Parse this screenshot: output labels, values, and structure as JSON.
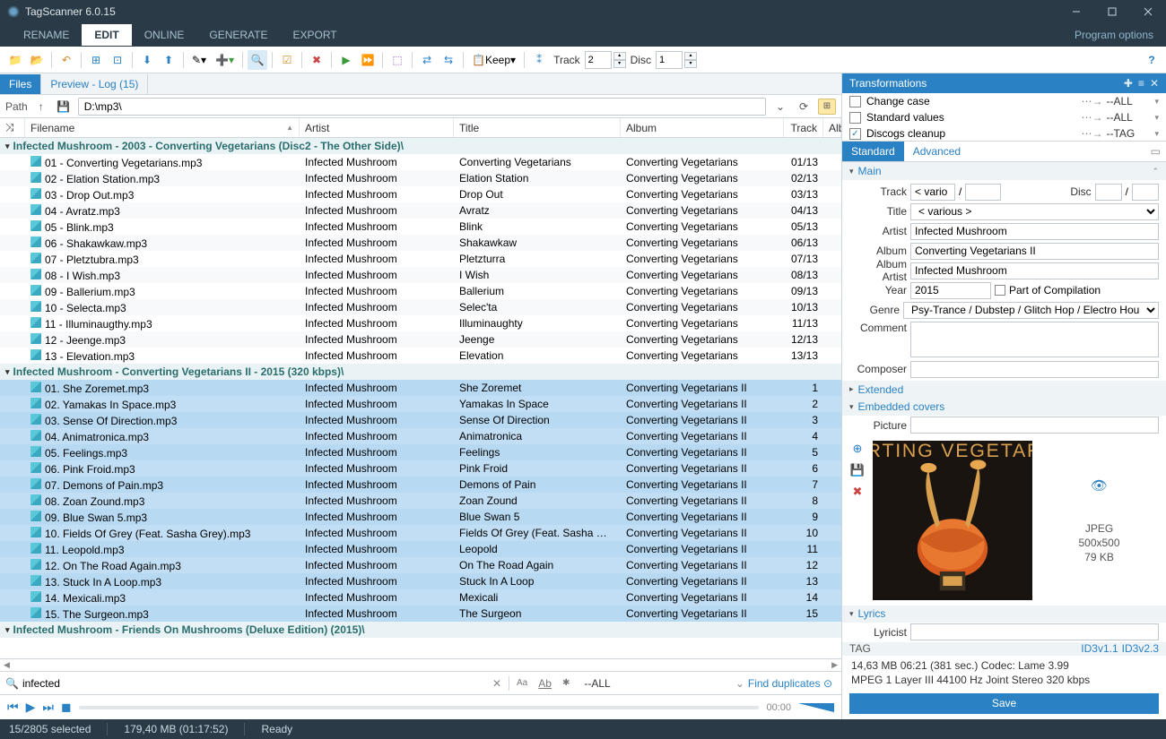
{
  "app": {
    "title": "TagScanner 6.0.15",
    "options_label": "Program options"
  },
  "menu": {
    "tabs": [
      "RENAME",
      "EDIT",
      "ONLINE",
      "GENERATE",
      "EXPORT"
    ],
    "active": 1
  },
  "leftTabs": {
    "files": "Files",
    "preview": "Preview - Log (15)"
  },
  "path": {
    "label": "Path",
    "value": "D:\\mp3\\"
  },
  "toolbar": {
    "keep": "Keep",
    "track_lbl": "Track",
    "track_val": "2",
    "disc_lbl": "Disc",
    "disc_val": "1"
  },
  "columns": {
    "filename": "Filename",
    "artist": "Artist",
    "title": "Title",
    "album": "Album",
    "track": "Track",
    "albart": "Alb"
  },
  "groups": [
    {
      "label": "Infected Mushroom - 2003 - Converting Vegetarians (Disc2 - The Other Side)\\",
      "selected": false,
      "rows": [
        {
          "fn": "01 - Converting Vegetarians.mp3",
          "ar": "Infected Mushroom",
          "ti": "Converting Vegetarians",
          "al": "Converting Vegetarians",
          "tr": "01/13"
        },
        {
          "fn": "02 - Elation Station.mp3",
          "ar": "Infected Mushroom",
          "ti": "Elation Station",
          "al": "Converting Vegetarians",
          "tr": "02/13"
        },
        {
          "fn": "03 - Drop Out.mp3",
          "ar": "Infected Mushroom",
          "ti": "Drop Out",
          "al": "Converting Vegetarians",
          "tr": "03/13"
        },
        {
          "fn": "04 - Avratz.mp3",
          "ar": "Infected Mushroom",
          "ti": "Avratz",
          "al": "Converting Vegetarians",
          "tr": "04/13"
        },
        {
          "fn": "05 - Blink.mp3",
          "ar": "Infected Mushroom",
          "ti": "Blink",
          "al": "Converting Vegetarians",
          "tr": "05/13"
        },
        {
          "fn": "06 - Shakawkaw.mp3",
          "ar": "Infected Mushroom",
          "ti": "Shakawkaw",
          "al": "Converting Vegetarians",
          "tr": "06/13"
        },
        {
          "fn": "07 - Pletztubra.mp3",
          "ar": "Infected Mushroom",
          "ti": "Pletzturra",
          "al": "Converting Vegetarians",
          "tr": "07/13"
        },
        {
          "fn": "08 - I Wish.mp3",
          "ar": "Infected Mushroom",
          "ti": "I Wish",
          "al": "Converting Vegetarians",
          "tr": "08/13"
        },
        {
          "fn": "09 - Ballerium.mp3",
          "ar": "Infected Mushroom",
          "ti": "Ballerium",
          "al": "Converting Vegetarians",
          "tr": "09/13"
        },
        {
          "fn": "10 - Selecta.mp3",
          "ar": "Infected Mushroom",
          "ti": "Selec'ta",
          "al": "Converting Vegetarians",
          "tr": "10/13"
        },
        {
          "fn": "11 - Illuminaugthy.mp3",
          "ar": "Infected Mushroom",
          "ti": "Illuminaughty",
          "al": "Converting Vegetarians",
          "tr": "11/13"
        },
        {
          "fn": "12 - Jeenge.mp3",
          "ar": "Infected Mushroom",
          "ti": "Jeenge",
          "al": "Converting Vegetarians",
          "tr": "12/13"
        },
        {
          "fn": "13 - Elevation.mp3",
          "ar": "Infected Mushroom",
          "ti": "Elevation",
          "al": "Converting Vegetarians",
          "tr": "13/13"
        }
      ]
    },
    {
      "label": "Infected Mushroom - Converting Vegetarians II - 2015 (320 kbps)\\",
      "selected": true,
      "rows": [
        {
          "fn": "01. She Zoremet.mp3",
          "ar": "Infected Mushroom",
          "ti": "She Zoremet",
          "al": "Converting Vegetarians II",
          "tr": "1"
        },
        {
          "fn": "02. Yamakas In Space.mp3",
          "ar": "Infected Mushroom",
          "ti": "Yamakas In Space",
          "al": "Converting Vegetarians II",
          "tr": "2"
        },
        {
          "fn": "03. Sense Of Direction.mp3",
          "ar": "Infected Mushroom",
          "ti": "Sense Of Direction",
          "al": "Converting Vegetarians II",
          "tr": "3"
        },
        {
          "fn": "04. Animatronica.mp3",
          "ar": "Infected Mushroom",
          "ti": "Animatronica",
          "al": "Converting Vegetarians II",
          "tr": "4"
        },
        {
          "fn": "05. Feelings.mp3",
          "ar": "Infected Mushroom",
          "ti": "Feelings",
          "al": "Converting Vegetarians II",
          "tr": "5"
        },
        {
          "fn": "06. Pink Froid.mp3",
          "ar": "Infected Mushroom",
          "ti": "Pink Froid",
          "al": "Converting Vegetarians II",
          "tr": "6"
        },
        {
          "fn": "07. Demons of Pain.mp3",
          "ar": "Infected Mushroom",
          "ti": "Demons of Pain",
          "al": "Converting Vegetarians II",
          "tr": "7"
        },
        {
          "fn": "08. Zoan Zound.mp3",
          "ar": "Infected Mushroom",
          "ti": "Zoan Zound",
          "al": "Converting Vegetarians II",
          "tr": "8"
        },
        {
          "fn": "09. Blue Swan 5.mp3",
          "ar": "Infected Mushroom",
          "ti": "Blue Swan 5",
          "al": "Converting Vegetarians II",
          "tr": "9"
        },
        {
          "fn": "10. Fields Of Grey (Feat. Sasha Grey).mp3",
          "ar": "Infected Mushroom",
          "ti": "Fields Of Grey (Feat. Sasha Grey)",
          "al": "Converting Vegetarians II",
          "tr": "10"
        },
        {
          "fn": "11. Leopold.mp3",
          "ar": "Infected Mushroom",
          "ti": "Leopold",
          "al": "Converting Vegetarians II",
          "tr": "11"
        },
        {
          "fn": "12. On The Road Again.mp3",
          "ar": "Infected Mushroom",
          "ti": "On The Road Again",
          "al": "Converting Vegetarians II",
          "tr": "12"
        },
        {
          "fn": "13. Stuck In A Loop.mp3",
          "ar": "Infected Mushroom",
          "ti": "Stuck In A Loop",
          "al": "Converting Vegetarians II",
          "tr": "13"
        },
        {
          "fn": "14. Mexicali.mp3",
          "ar": "Infected Mushroom",
          "ti": "Mexicali",
          "al": "Converting Vegetarians II",
          "tr": "14"
        },
        {
          "fn": "15. The Surgeon.mp3",
          "ar": "Infected Mushroom",
          "ti": "The Surgeon",
          "al": "Converting Vegetarians II",
          "tr": "15"
        }
      ]
    },
    {
      "label": "Infected Mushroom - Friends On Mushrooms (Deluxe Edition) (2015)\\",
      "selected": false,
      "rows": []
    }
  ],
  "search": {
    "value": "infected",
    "scope": "--ALL",
    "dup": "Find duplicates"
  },
  "player": {
    "time": "00:00"
  },
  "transformations": {
    "title": "Transformations",
    "rows": [
      {
        "checked": false,
        "name": "Change case",
        "target": "--ALL"
      },
      {
        "checked": false,
        "name": "Standard values",
        "target": "--ALL"
      },
      {
        "checked": true,
        "name": "Discogs cleanup",
        "target": "--TAG"
      }
    ]
  },
  "rightTabs": {
    "standard": "Standard",
    "advanced": "Advanced"
  },
  "sections": {
    "main": "Main",
    "extended": "Extended",
    "covers": "Embedded covers",
    "lyrics": "Lyrics"
  },
  "tags": {
    "track_lbl": "Track",
    "track_val": "< vario",
    "track_total": "",
    "disc_lbl": "Disc",
    "disc_val": "",
    "disc_total": "",
    "title_lbl": "Title",
    "title_val": "< various >",
    "artist_lbl": "Artist",
    "artist_val": "Infected Mushroom",
    "album_lbl": "Album",
    "album_val": "Converting Vegetarians II",
    "albart_lbl": "Album Artist",
    "albart_val": "Infected Mushroom",
    "year_lbl": "Year",
    "year_val": "2015",
    "comp_lbl": "Part of Compilation",
    "genre_lbl": "Genre",
    "genre_val": "Psy-Trance / Dubstep / Glitch Hop / Electro Hou",
    "comment_lbl": "Comment",
    "comment_val": "",
    "composer_lbl": "Composer",
    "composer_val": "",
    "picture_lbl": "Picture",
    "lyricist_lbl": "Lyricist",
    "lyricist_val": ""
  },
  "cover": {
    "format": "JPEG",
    "dim": "500x500",
    "size": "79 KB"
  },
  "tagfoot": {
    "left": "TAG",
    "r1": "ID3v1.1",
    "r2": "ID3v2.3"
  },
  "fileinfo": {
    "line1": "14,63 MB  06:21 (381 sec.)  Codec: Lame 3.99",
    "line2": "MPEG 1 Layer III  44100 Hz  Joint Stereo  320 kbps"
  },
  "save": "Save",
  "status": {
    "sel": "15/2805 selected",
    "size": "179,40 MB (01:17:52)",
    "ready": "Ready"
  }
}
